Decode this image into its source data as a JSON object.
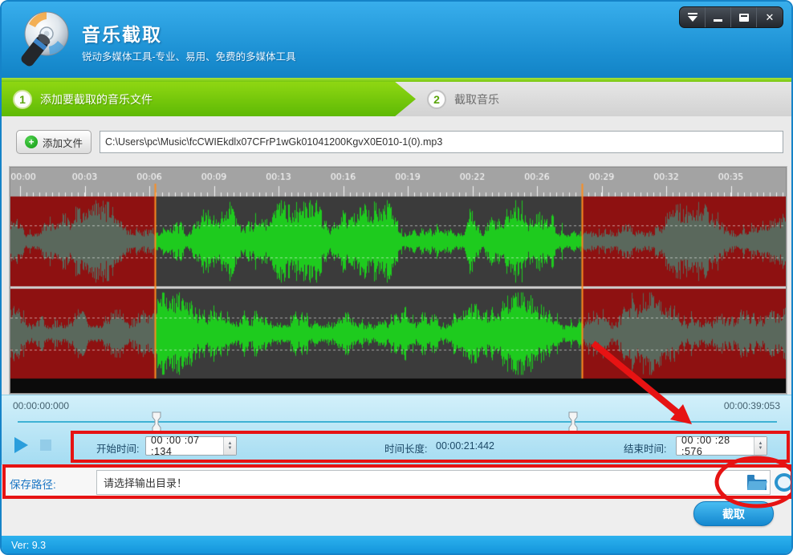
{
  "window": {
    "title": "音乐截取",
    "subtitle": "锐动多媒体工具-专业、易用、免费的多媒体工具",
    "close_glyph": "✕",
    "version": "Ver: 9.3"
  },
  "steps": [
    {
      "num": "1",
      "label": "添加要截取的音乐文件"
    },
    {
      "num": "2",
      "label": "截取音乐"
    }
  ],
  "file_row": {
    "add_button": "添加文件",
    "plus_glyph": "+",
    "file_path": "C:\\Users\\pc\\Music\\fcCWIEkdlx07CFrP1wGk01041200KgvX0E010-1(0).mp3"
  },
  "timeline": {
    "ruler_labels": [
      "00:00",
      "00:03",
      "00:06",
      "00:09",
      "00:13",
      "00:16",
      "00:19",
      "00:22",
      "00:26",
      "00:29",
      "00:32",
      "00:35"
    ],
    "start_sec": 7.134,
    "end_sec": 28.576,
    "total_sec": 39.053
  },
  "waveform_colors": {
    "bg_selected": "#3b3b3b",
    "bg_unselected": "#8e1111",
    "wave_selected": "#1ecb1e",
    "wave_unselected": "#5a685c",
    "marker": "#ff8d1f",
    "ruler_bg": "#a3a3a3",
    "ruler_tick": "#f2f2f2",
    "ruler_text": "#ffffff",
    "divider": "#cfcfcf",
    "bottom_strip": "#0b0b0b",
    "guide_dash": "rgba(255,255,255,0.55)"
  },
  "position": {
    "current": "00:00:00:000",
    "total": "00:00:39:053"
  },
  "time_controls": {
    "start_label": "开始时间:",
    "start_value": "00 :00 :07 :134",
    "duration_label": "时间长度:",
    "duration_value": "00:00:21:442",
    "end_label": "结束时间:",
    "end_value": "00 :00 :28 :576",
    "spin_up": "▲",
    "spin_down": "▼"
  },
  "save_row": {
    "label": "保存路径:",
    "value": "请选择输出目录！"
  },
  "cut_button": "截取",
  "annotation_color": "#e61313"
}
